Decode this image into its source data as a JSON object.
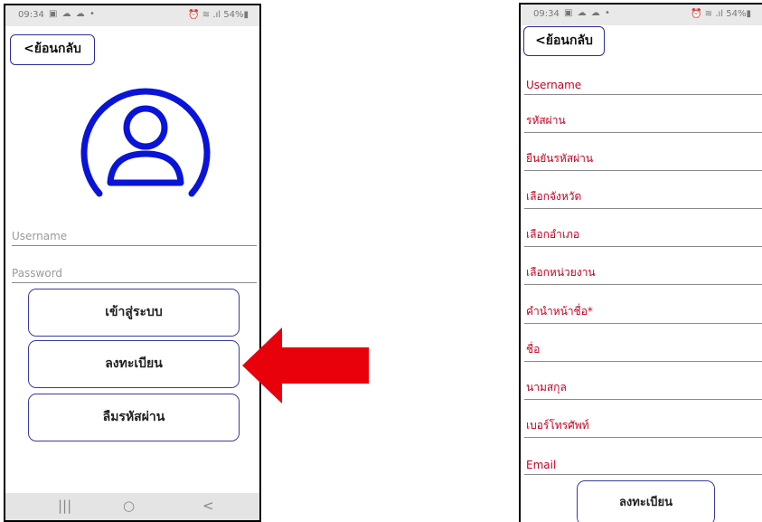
{
  "left_phone": {
    "status": {
      "time": "09:34",
      "icons": "▣ ☁ ☁ •",
      "right": "⏰ ≋ .ıl 54%▮"
    },
    "back_label": "<ย้อนกลับ",
    "username_placeholder": "Username",
    "password_placeholder": "Password",
    "buttons": {
      "login": "เข้าสู่ระบบ",
      "register": "ลงทะเบียน",
      "forgot": "ลืมรหัสผ่าน"
    },
    "nav": {
      "recent": "|||",
      "home": "○",
      "back": "<"
    }
  },
  "right_phone": {
    "status": {
      "time": "09:34",
      "icons": "▣ ☁ ☁ •",
      "right": "⏰ ≋ .ıl 54%▮"
    },
    "back_label": "<ย้อนกลับ",
    "fields": [
      "Username",
      "รหัสผ่าน",
      "ยืนยันรหัสผ่าน",
      "เลือกจังหวัด",
      "เลือกอำเภอ",
      "เลือกหน่วยงาน",
      "คำนำหน้าชื่อ*",
      "ชื่อ",
      "นามสกุล",
      "เบอร์โทรศัพท์",
      "Email"
    ],
    "register_label": "ลงทะเบียน"
  },
  "colors": {
    "accent": "#0a14d8",
    "label_red": "#c8001e",
    "arrow_red": "#e8000b"
  }
}
